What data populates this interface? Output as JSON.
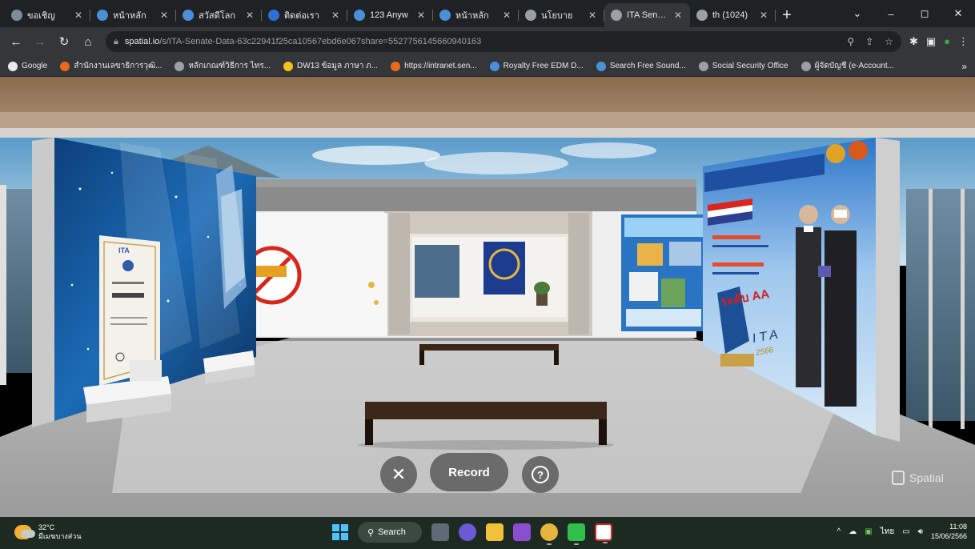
{
  "browser": {
    "tabs": [
      {
        "title": "ขอเชิญ",
        "color": "#7e8b9a",
        "active": false
      },
      {
        "title": "หน้าหลัก",
        "color": "#4a90d9",
        "active": false
      },
      {
        "title": "สวัสดีโลก",
        "color": "#4a90d9",
        "active": false
      },
      {
        "title": "ติดต่อเรา",
        "color": "#2f6fd8",
        "active": false
      },
      {
        "title": "123 Anyw",
        "color": "#4a90d9",
        "active": false
      },
      {
        "title": "หน้าหลัก",
        "color": "#4a90d9",
        "active": false
      },
      {
        "title": "นโยบาย",
        "color": "#9aa0a6",
        "active": false
      },
      {
        "title": "ITA Senate",
        "color": "#9aa0a6",
        "active": true
      },
      {
        "title": "th (1024)",
        "color": "#9aa0a6",
        "active": false
      }
    ],
    "url_host": "spatial.io",
    "url_path": "/s/ITA-Senate-Data-63c22941f25ca10567ebd6e067share=5527756145660940163",
    "bookmarks": [
      {
        "label": "Google",
        "color": "#e8eaed"
      },
      {
        "label": "สำนักงานเลขาธิการวุฒิ...",
        "color": "#e86a1a"
      },
      {
        "label": "หลักเกณฑ์วิธีการ ไทร...",
        "color": "#9aa0a6"
      },
      {
        "label": "DW13 ข้อมูล ภาษา ภ...",
        "color": "#f0c419"
      },
      {
        "label": "https://intranet.sen...",
        "color": "#e86a1a"
      },
      {
        "label": "Royalty Free EDM D...",
        "color": "#4a90d9"
      },
      {
        "label": "Search Free Sound...",
        "color": "#4a90d9"
      },
      {
        "label": "Social Security Office",
        "color": "#9aa0a6"
      },
      {
        "label": "ผู้จัดบัญชี (e-Account...",
        "color": "#9aa0a6"
      }
    ]
  },
  "scene": {
    "left_board": {
      "title": "ITA"
    },
    "right_board": {
      "headline": "ระดับ AA",
      "ita": "ITA",
      "year": "2566"
    },
    "record_label": "Record",
    "brand": "Spatial"
  },
  "taskbar": {
    "temp": "32°C",
    "weather": "มีเมฆบางส่วน",
    "search": "Search",
    "lang": "ไทย",
    "time": "11:08",
    "date": "15/06/2566"
  }
}
